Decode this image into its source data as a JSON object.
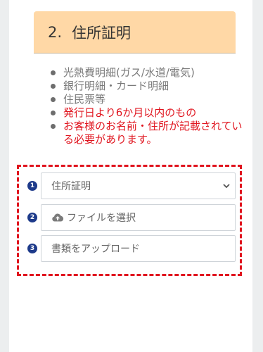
{
  "section": {
    "number": "2.",
    "title": "住所証明"
  },
  "bullets": [
    {
      "text": "光熱費明細(ガス/水道/電気)",
      "highlight": false
    },
    {
      "text": "銀行明細・カード明細",
      "highlight": false
    },
    {
      "text": "住民票等",
      "highlight": false
    },
    {
      "text": "発行日より6か月以内のもの",
      "highlight": true
    },
    {
      "text": "お客様のお名前・住所が記載されている必要があります。",
      "highlight": true
    }
  ],
  "form": {
    "step1": {
      "badge": "1",
      "select_value": "住所証明"
    },
    "step2": {
      "badge": "2",
      "label": "ファイルを選択",
      "icon": "cloud-upload-icon"
    },
    "step3": {
      "badge": "3",
      "label": "書類をアップロード"
    }
  },
  "colors": {
    "heading_bg": "#ffd8a6",
    "highlight_text": "#e0141e",
    "badge_bg": "#1d3a8a",
    "dashed_border": "#e0141e"
  }
}
